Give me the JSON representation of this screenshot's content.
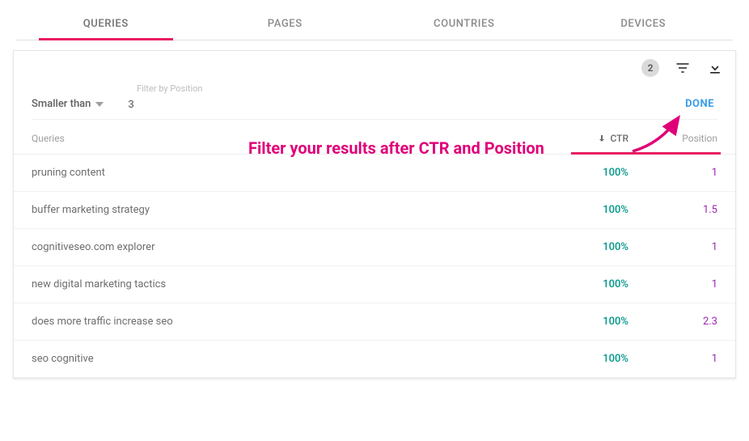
{
  "tabs": {
    "items": [
      {
        "label": "QUERIES",
        "active": true
      },
      {
        "label": "PAGES",
        "active": false
      },
      {
        "label": "COUNTRIES",
        "active": false
      },
      {
        "label": "DEVICES",
        "active": false
      }
    ]
  },
  "toolbar": {
    "badge_count": "2"
  },
  "filter": {
    "label": "Filter by Position",
    "operator": "Smaller than",
    "value": "3",
    "done_label": "DONE"
  },
  "columns": {
    "queries": "Queries",
    "ctr": "CTR",
    "position": "Position"
  },
  "rows": [
    {
      "query": "pruning content",
      "ctr": "100%",
      "position": "1"
    },
    {
      "query": "buffer marketing strategy",
      "ctr": "100%",
      "position": "1.5"
    },
    {
      "query": "cognitiveseo.com explorer",
      "ctr": "100%",
      "position": "1"
    },
    {
      "query": "new digital marketing tactics",
      "ctr": "100%",
      "position": "1"
    },
    {
      "query": "does more traffic increase seo",
      "ctr": "100%",
      "position": "2.3"
    },
    {
      "query": "seo cognitive",
      "ctr": "100%",
      "position": "1"
    }
  ],
  "annotation": {
    "text": "Filter your results after CTR and Position"
  }
}
